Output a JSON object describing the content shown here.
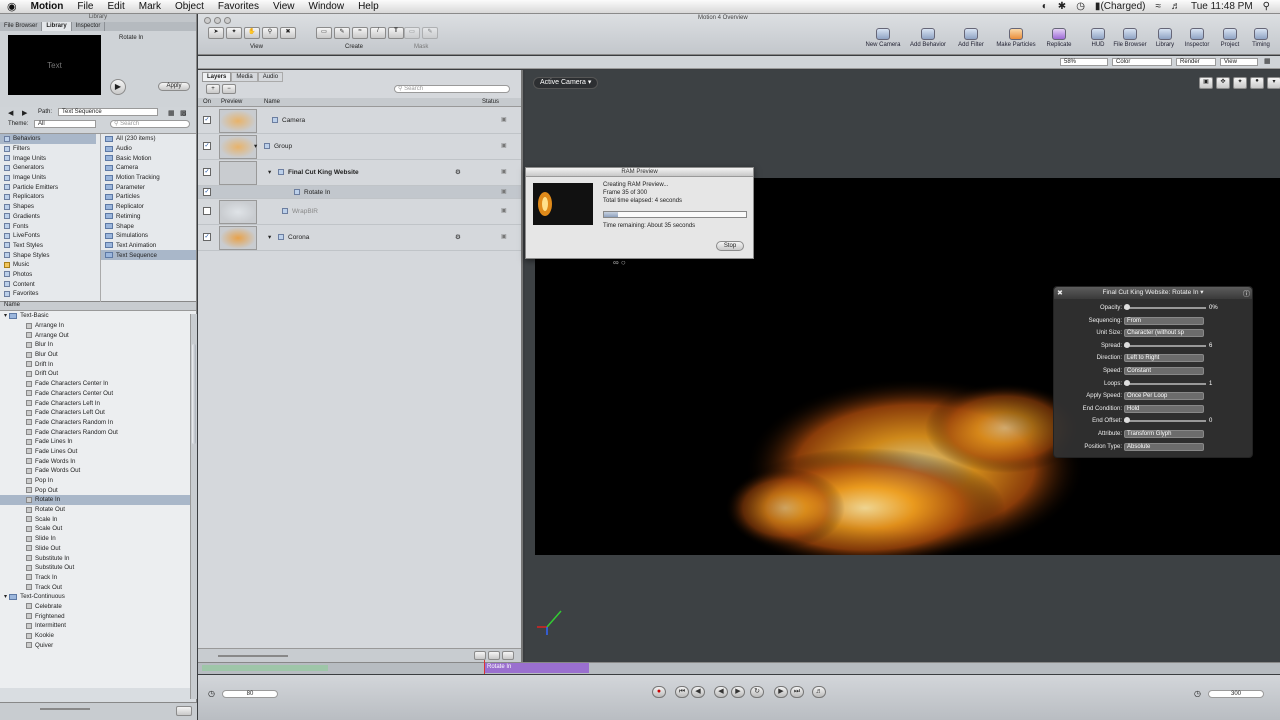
{
  "menubar": {
    "apple": "",
    "app": "Motion",
    "items": [
      "File",
      "Edit",
      "Mark",
      "Object",
      "Favorites",
      "View",
      "Window",
      "Help"
    ],
    "battery": "(Charged)",
    "clock": "Tue 11:48 PM"
  },
  "left": {
    "window_title": "Library",
    "tabs": [
      "File Browser",
      "Library",
      "Inspector"
    ],
    "preview_title": "Rotate In",
    "preview_text": "Text",
    "apply": "Apply",
    "path_label": "Path:",
    "path_value": "Text Sequence",
    "theme_label": "Theme:",
    "theme_value": "All",
    "search_placeholder": "Search",
    "categories": [
      "Behaviors",
      "Filters",
      "Image Units",
      "Generators",
      "Image Units",
      "Particle Emitters",
      "Replicators",
      "Shapes",
      "Gradients",
      "Fonts",
      "LiveFonts",
      "Text Styles",
      "Shape Styles",
      "Music",
      "Photos",
      "Content",
      "Favorites"
    ],
    "subcategories": [
      "All (230 items)",
      "Audio",
      "Basic Motion",
      "Camera",
      "Motion Tracking",
      "Parameter",
      "Particles",
      "Replicator",
      "Retiming",
      "Shape",
      "Simulations",
      "Text Animation",
      "Text Sequence"
    ],
    "list_header": "Name",
    "group1": "Text-Basic",
    "items1": [
      "Arrange In",
      "Arrange Out",
      "Blur In",
      "Blur Out",
      "Drift In",
      "Drift Out",
      "Fade Characters Center In",
      "Fade Characters Center Out",
      "Fade Characters Left In",
      "Fade Characters Left Out",
      "Fade Characters Random In",
      "Fade Characters Random Out",
      "Fade Lines In",
      "Fade Lines Out",
      "Fade Words In",
      "Fade Words Out",
      "Pop In",
      "Pop Out",
      "Rotate In",
      "Rotate Out",
      "Scale In",
      "Scale Out",
      "Slide In",
      "Slide Out",
      "Substitute In",
      "Substitute Out",
      "Track In",
      "Track Out"
    ],
    "group2": "Text-Continuous",
    "items2": [
      "Celebrate",
      "Frightened",
      "Intermittent",
      "Kookie",
      "Quiver"
    ]
  },
  "toolbar": {
    "window_title": "Motion 4 Overview",
    "group_view": "View",
    "group_create": "Create",
    "group_mask": "Mask",
    "right": [
      "New Camera",
      "Add Behavior",
      "Add Filter",
      "Make Particles",
      "Replicate",
      "HUD",
      "File Browser",
      "Library",
      "Inspector",
      "Project",
      "Timing"
    ],
    "zoom": "58%",
    "color": "Color",
    "render": "Render",
    "view": "View"
  },
  "layers": {
    "tabs": [
      "Layers",
      "Media",
      "Audio"
    ],
    "search": "Search",
    "cols": [
      "On",
      "Preview",
      "Name",
      "Status"
    ],
    "rows": [
      "Camera",
      "Group",
      "Final Cut King Website",
      "Rotate In",
      "WrapBlR",
      "Corona"
    ]
  },
  "canvas": {
    "camera": "Active Camera"
  },
  "ram": {
    "title": "RAM Preview",
    "l1": "Creating RAM Preview...",
    "l2": "Frame 35 of 300",
    "l3": "Total time elapsed:  4 seconds",
    "l4": "Time remaining:  About 35 seconds",
    "stop": "Stop",
    "progress": 0.1
  },
  "hud": {
    "title": "Final Cut King Website: Rotate In",
    "rows": [
      {
        "label": "Opacity:",
        "value": "0%",
        "kind": "slider"
      },
      {
        "label": "Sequencing:",
        "value": "From",
        "kind": "select"
      },
      {
        "label": "Unit Size:",
        "value": "Character (without sp",
        "kind": "select"
      },
      {
        "label": "Spread:",
        "value": "6",
        "kind": "slider"
      },
      {
        "label": "Direction:",
        "value": "Left to Right",
        "kind": "select"
      },
      {
        "label": "Speed:",
        "value": "Constant",
        "kind": "select"
      },
      {
        "label": "Loops:",
        "value": "1",
        "kind": "slider"
      },
      {
        "label": "Apply Speed:",
        "value": "Once Per Loop",
        "kind": "select"
      },
      {
        "label": "End Condition:",
        "value": "Hold",
        "kind": "select"
      },
      {
        "label": "End Offset:",
        "value": "0",
        "kind": "slider"
      },
      {
        "label": "Attribute:",
        "value": "Transform Glyph",
        "kind": "select"
      },
      {
        "label": "Position Type:",
        "value": "Absolute",
        "kind": "select"
      }
    ]
  },
  "timeline": {
    "clip": "Rotate In",
    "frame_left": "80",
    "frame_right": "300"
  }
}
